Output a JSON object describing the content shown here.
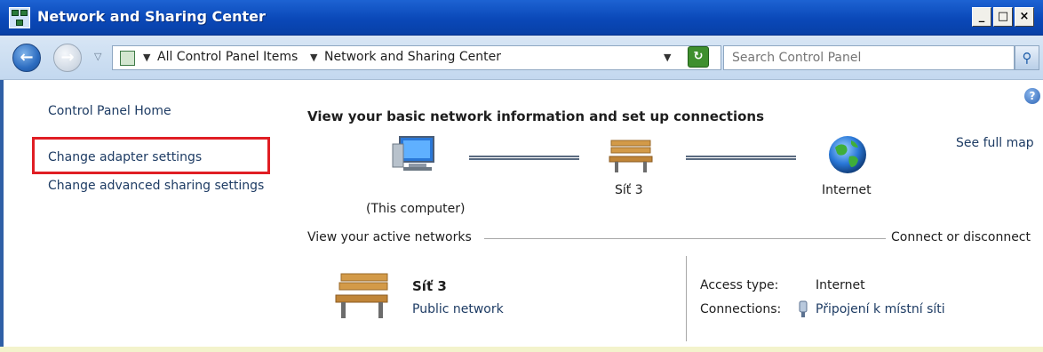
{
  "window": {
    "title": "Network and Sharing Center",
    "controls": {
      "minimize": "_",
      "maximize": "□",
      "close": "×"
    }
  },
  "address_bar": {
    "breadcrumb": [
      "All Control Panel Items",
      "Network and Sharing Center"
    ],
    "search_placeholder": "Search Control Panel",
    "icons": {
      "back": "back-arrow-icon",
      "forward": "forward-arrow-icon",
      "refresh": "refresh-icon",
      "search": "magnifier-icon"
    }
  },
  "left_pane": {
    "links": [
      "Control Panel Home",
      "Change adapter settings",
      "Change advanced sharing settings"
    ],
    "highlighted_link": "Change adapter settings",
    "highlight_color": "#e01e24"
  },
  "main": {
    "title": "View your basic network information and set up connections",
    "see_full_map": "See full map",
    "map_nodes": [
      {
        "label": "(This computer)",
        "icon": "computer-icon"
      },
      {
        "label": "Síť 3",
        "icon": "bench-icon"
      },
      {
        "label": "Internet",
        "icon": "globe-icon"
      }
    ],
    "active_networks_label": "View your active networks",
    "connect_label": "Connect or disconnect",
    "network": {
      "name": "Síť 3",
      "type": "Public network",
      "icon": "bench-icon",
      "access_type_label": "Access type:",
      "access_type_value": "Internet",
      "connections_label": "Connections:",
      "connections_value": "Připojení k místní síti",
      "connection_icon": "network-adapter-icon"
    }
  },
  "colors": {
    "titlebar": "#0a48b8",
    "link": "#1e3c64"
  }
}
